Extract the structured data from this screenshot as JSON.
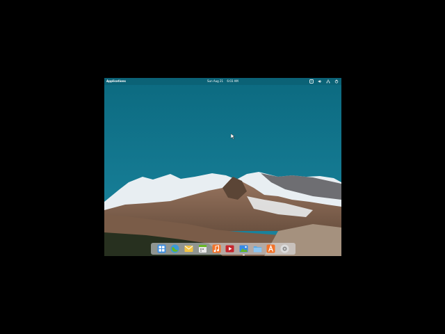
{
  "topbar": {
    "applications_label": "Applications",
    "clock_date": "Sun Aug 21",
    "clock_time": "6:03 AM",
    "tray_icons": [
      "notifications-icon",
      "volume-icon",
      "network-icon",
      "power-icon"
    ]
  },
  "wallpaper": {
    "sky_color": "#0f6f84",
    "snow_color": "#eef3f6",
    "rock_color": "#8a6a55",
    "forest_color": "#2a3322"
  },
  "dock": {
    "items": [
      {
        "name": "multitasking-view-icon",
        "color": "#3d8ee0"
      },
      {
        "name": "web-browser-icon",
        "color": "#3b9ad9"
      },
      {
        "name": "mail-icon",
        "color": "#f1c343"
      },
      {
        "name": "calendar-icon",
        "color": "#e9e9e9"
      },
      {
        "name": "music-icon",
        "color": "#f37329"
      },
      {
        "name": "videos-icon",
        "color": "#c6262e"
      },
      {
        "name": "photos-icon",
        "color": "#3689e6"
      },
      {
        "name": "files-icon",
        "color": "#5aa9e6"
      },
      {
        "name": "appcenter-icon",
        "color": "#f37329"
      },
      {
        "name": "system-settings-icon",
        "color": "#dcdcdc"
      }
    ]
  }
}
